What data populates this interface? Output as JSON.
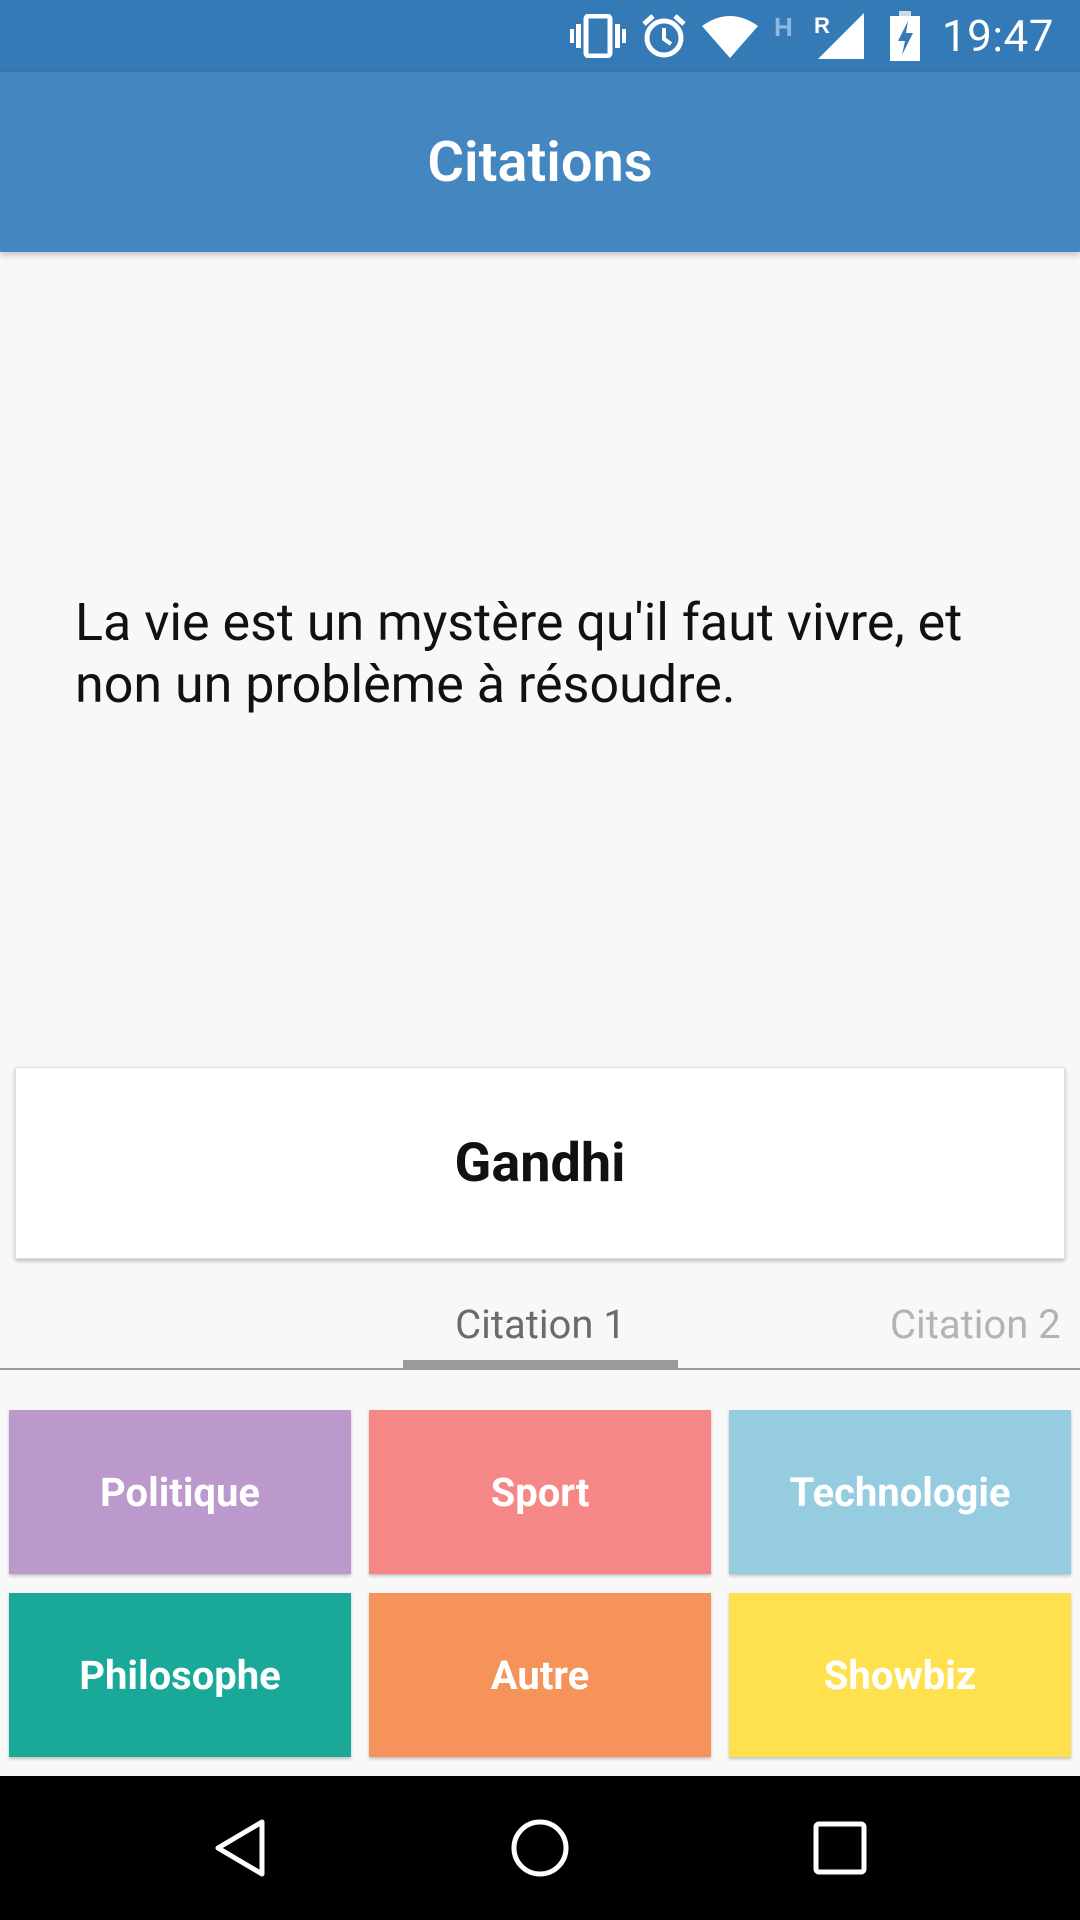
{
  "status_bar": {
    "time": "19:47",
    "icons": [
      "vibrate-icon",
      "alarm-icon",
      "wifi-icon",
      "h-network-icon",
      "roaming-signal-icon",
      "battery-charging-icon"
    ],
    "network_letter": "H",
    "roaming_letter": "R"
  },
  "app_bar": {
    "title": "Citations",
    "color": "#4486c0"
  },
  "quote": {
    "text": "La vie est un mystère qu'il faut vivre, et non un problème à résoudre."
  },
  "author": {
    "name": "Gandhi"
  },
  "tabs": [
    {
      "label": "Citation 1",
      "selected": true
    },
    {
      "label": "Citation 2",
      "selected": false
    }
  ],
  "categories": [
    {
      "label": "Politique",
      "color": "#bb99cc"
    },
    {
      "label": "Sport",
      "color": "#f58787"
    },
    {
      "label": "Technologie",
      "color": "#96cce0"
    },
    {
      "label": "Philosophe",
      "color": "#1aa898"
    },
    {
      "label": "Autre",
      "color": "#f5935b"
    },
    {
      "label": "Showbiz",
      "color": "#ffe150"
    }
  ],
  "nav_bar": {
    "buttons": [
      "back-icon",
      "home-icon",
      "recents-icon"
    ]
  }
}
